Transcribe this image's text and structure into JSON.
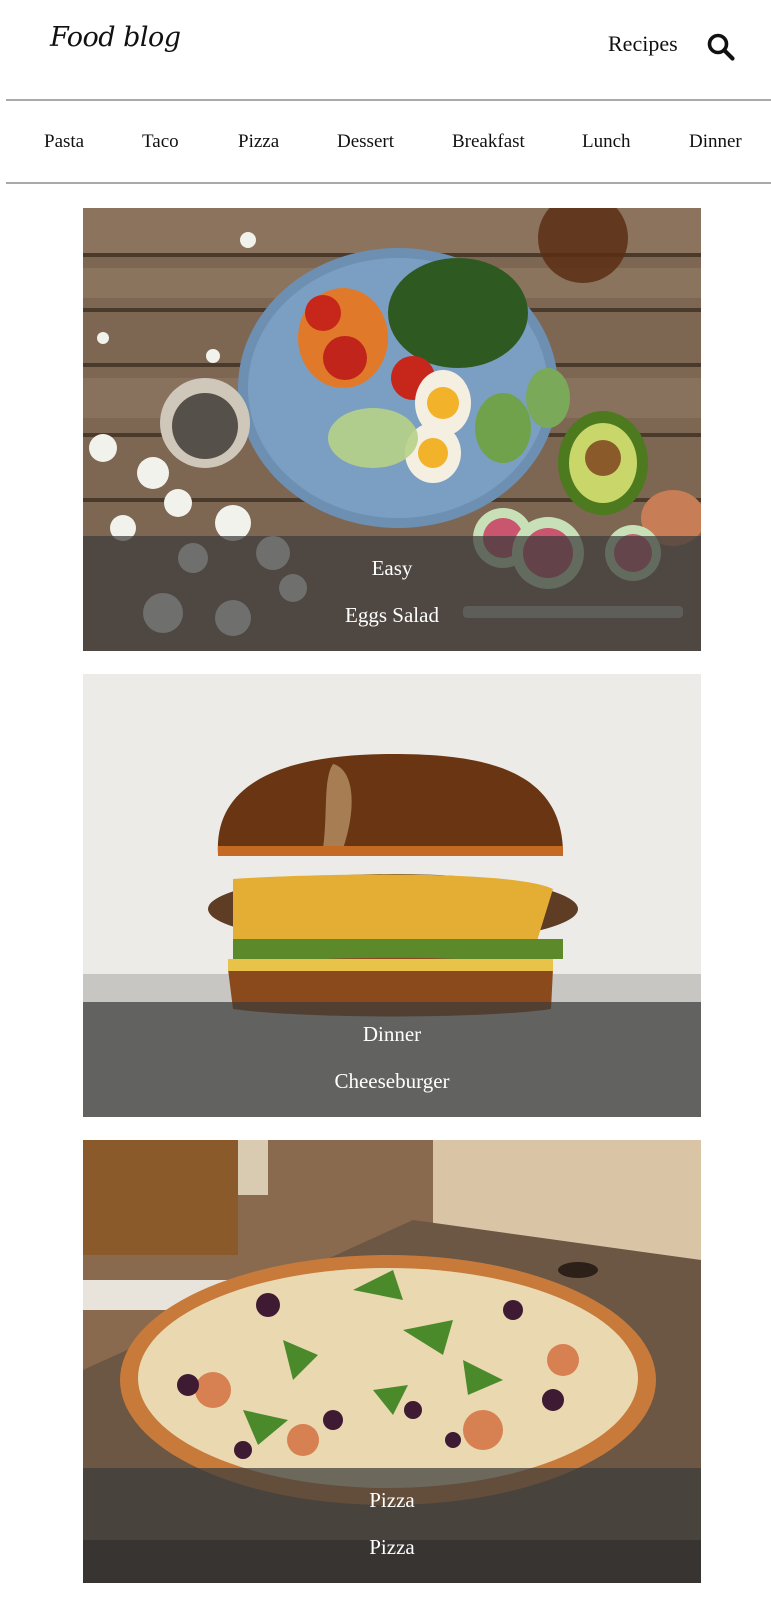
{
  "header": {
    "logo": "Food blog",
    "recipes_link": "Recipes",
    "search_icon": "search-icon"
  },
  "nav": {
    "items": [
      "Pasta",
      "Taco",
      "Pizza",
      "Dessert",
      "Breakfast",
      "Lunch",
      "Dinner"
    ]
  },
  "cards": [
    {
      "category": "Easy",
      "title": "Eggs Salad"
    },
    {
      "category": "Dinner",
      "title": "Cheeseburger"
    },
    {
      "category": "Pizza",
      "title": "Pizza"
    }
  ],
  "colors": {
    "caption_overlay": "#3c3c3c",
    "divider": "#a9a9a9",
    "text": "#111111"
  }
}
